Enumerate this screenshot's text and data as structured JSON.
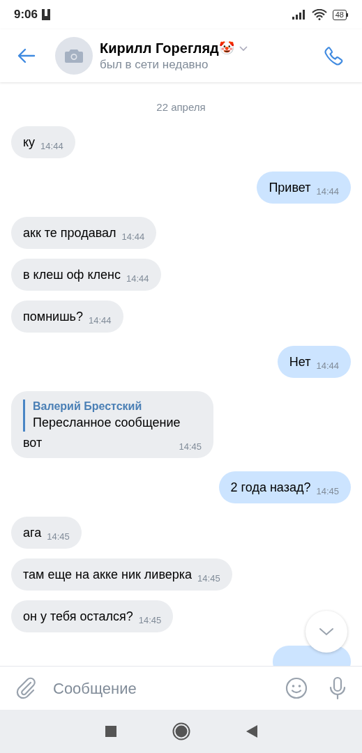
{
  "status_bar": {
    "time": "9:06",
    "battery": "48"
  },
  "header": {
    "name": "Кирилл Горегляд",
    "emoji": "🤡",
    "status": "был в сети недавно"
  },
  "date_separator": "22 апреля",
  "messages": [
    {
      "kind": "text",
      "outgoing": false,
      "text": "ку",
      "time": "14:44"
    },
    {
      "kind": "text",
      "outgoing": true,
      "text": "Привет",
      "time": "14:44"
    },
    {
      "kind": "text",
      "outgoing": false,
      "text": "акк те продавал",
      "time": "14:44"
    },
    {
      "kind": "text",
      "outgoing": false,
      "text": "в клеш оф кленс",
      "time": "14:44"
    },
    {
      "kind": "text",
      "outgoing": false,
      "text": "помнишь?",
      "time": "14:44"
    },
    {
      "kind": "text",
      "outgoing": true,
      "text": "Нет",
      "time": "14:44"
    },
    {
      "kind": "forward",
      "outgoing": false,
      "author": "Валерий Брестский",
      "forwarded_text": "Пересланное сообщение",
      "text": "вот",
      "time": "14:45"
    },
    {
      "kind": "text",
      "outgoing": true,
      "text": "2 года назад?",
      "time": "14:45"
    },
    {
      "kind": "text",
      "outgoing": false,
      "text": "ага",
      "time": "14:45"
    },
    {
      "kind": "text",
      "outgoing": false,
      "text": "там еще на акке ник ливерка",
      "time": "14:45"
    },
    {
      "kind": "text",
      "outgoing": false,
      "text": "он у тебя остался?",
      "time": "14:45"
    },
    {
      "kind": "clipped",
      "outgoing": true
    }
  ],
  "composer": {
    "placeholder": "Сообщение"
  }
}
